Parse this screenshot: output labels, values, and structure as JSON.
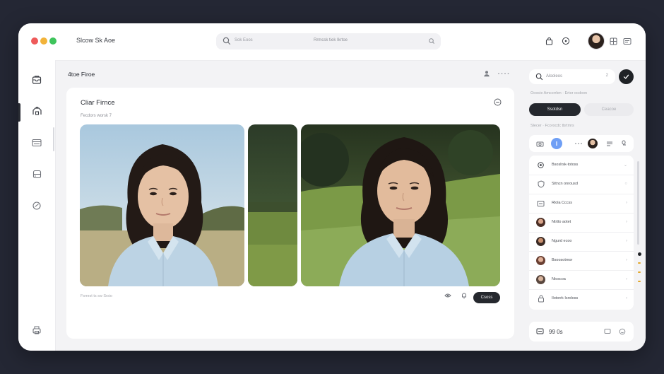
{
  "window": {
    "title": "Slcow Sk Aoe",
    "traffic_lights": [
      "#ee5a5a",
      "#f2b33a",
      "#3fc45c"
    ]
  },
  "search": {
    "placeholder": "Sok Eoos",
    "center_text": "Rrmcsk tiek Ikrtoe"
  },
  "topbar": {
    "icons": [
      "bag-icon",
      "help-icon",
      "avatar",
      "grid-icon",
      "layout-icon"
    ]
  },
  "sidebar": {
    "items": [
      "inbox-icon",
      "puzzle-icon",
      "card-icon",
      "storage-icon",
      "sync-icon",
      "printer-icon"
    ]
  },
  "main": {
    "title": "4toe Firoe",
    "tools": [
      "person-icon",
      "more-icon"
    ],
    "card": {
      "title": "Cliar Firnce",
      "subtitle": "Fecdors worsk 7",
      "caption": "Fsmrst ts sw Srsio",
      "save_label": "Csoss",
      "photos": [
        {
          "name": "portrait-sky",
          "description_icon": "photo"
        },
        {
          "name": "forest-strip",
          "description_icon": "photo"
        },
        {
          "name": "portrait-field",
          "description_icon": "photo"
        }
      ]
    }
  },
  "right_panel": {
    "search_placeholder": "Alooleos",
    "search_count": "2",
    "label_top": "Ooocie Amcorrlen · Ertor ocdoon",
    "tab_active": "Ssotdsn",
    "tab_inactive": "Ceacoe",
    "label_mid": "Slecer · Fcorocdc tbrtmrs",
    "list": [
      {
        "icon": "settings-icon",
        "label": "Bsoslrsk-totoss",
        "kind": "icon"
      },
      {
        "icon": "shield-icon",
        "label": "Sttncn onrousd",
        "kind": "icon"
      },
      {
        "icon": "tag-icon",
        "label": "Rlola Cccss",
        "kind": "icon"
      },
      {
        "icon": "avatar",
        "label": "Ntrtto aotet",
        "kind": "avatar"
      },
      {
        "icon": "avatar",
        "label": "Ngurd ecoo",
        "kind": "avatar"
      },
      {
        "icon": "avatar",
        "label": "Bsoosotmor",
        "kind": "avatar"
      },
      {
        "icon": "avatar",
        "label": "Nioscoa",
        "kind": "avatar"
      },
      {
        "icon": "lock-icon",
        "label": "Ilotorrk Isroloss",
        "kind": "icon"
      }
    ],
    "bottom_value": "99 0s"
  },
  "colors": {
    "background": "#242734",
    "accent_dark": "#25282e",
    "accent_blue": "#6f9ff5",
    "tick_orange": "#e2a728"
  }
}
